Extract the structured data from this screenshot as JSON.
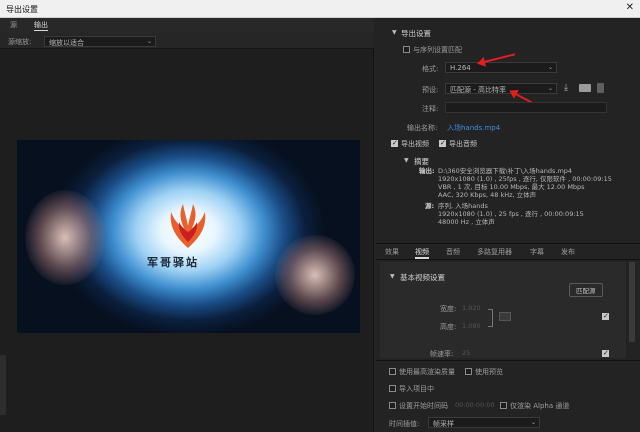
{
  "window": {
    "title": "导出设置",
    "close_glyph": "✕"
  },
  "left": {
    "tabs": [
      "源",
      "输出"
    ],
    "active_tab": 1,
    "source_scaling_label": "源缩放:",
    "source_scaling_value": "缩放以适合",
    "preview_logo_text": "军哥驿站"
  },
  "export_settings": {
    "section_title": "导出设置",
    "match_sequence_label": "与序列设置匹配",
    "format_label": "格式:",
    "format_value": "H.264",
    "preset_label": "预设:",
    "preset_value": "匹配源 - 高比特率",
    "comment_label": "注释:",
    "output_name_label": "输出名称:",
    "output_name_value": "入场hands.mp4",
    "export_video_label": "导出视频",
    "export_audio_label": "导出音频",
    "summary_title": "摘要",
    "output_label": "输出:",
    "output_lines": [
      "D:\\360安全浏览器下载\\补丁\\入场hands.mp4",
      "1920x1080 (1.0) , 25fps , 逐行, 仅限软件 , 00:00:09:15",
      "VBR , 1 次, 目标 10.00 Mbps, 最大 12.00 Mbps",
      "AAC, 320 Kbps, 48 kHz, 立体声"
    ],
    "source_label": "源:",
    "source_lines": [
      "序列, 入场hands",
      "1920x1080 (1.0) , 25 fps , 逐行 , 00:00:09:15",
      "48000 Hz , 立体声"
    ]
  },
  "subtabs": [
    "效果",
    "视频",
    "音频",
    "多路复用器",
    "字幕",
    "发布"
  ],
  "active_subtab": 1,
  "video": {
    "section_title": "基本视频设置",
    "match_source_button": "匹配源",
    "width_label": "宽度:",
    "width_value": "1,920",
    "height_label": "高度:",
    "height_value": "1,080",
    "framerate_label": "帧速率:",
    "framerate_value": "25"
  },
  "bottom": {
    "max_render_quality": "使用最高渲染质量",
    "use_previews": "使用预览",
    "import_into_project": "导入项目中",
    "set_start_timecode": "设置开始时间码",
    "start_timecode_value": "00:00:00:00",
    "render_alpha_only": "仅渲染 Alpha 通道",
    "time_interpolation_label": "时间插值:",
    "time_interpolation_value": "帧采样"
  },
  "colors": {
    "accent_arrow": "#e21e1e",
    "link": "#3d8fe0"
  },
  "icons": [
    "chevron-down-icon",
    "save-preset-icon",
    "import-preset-icon",
    "delete-preset-icon",
    "link-chain-icon"
  ]
}
